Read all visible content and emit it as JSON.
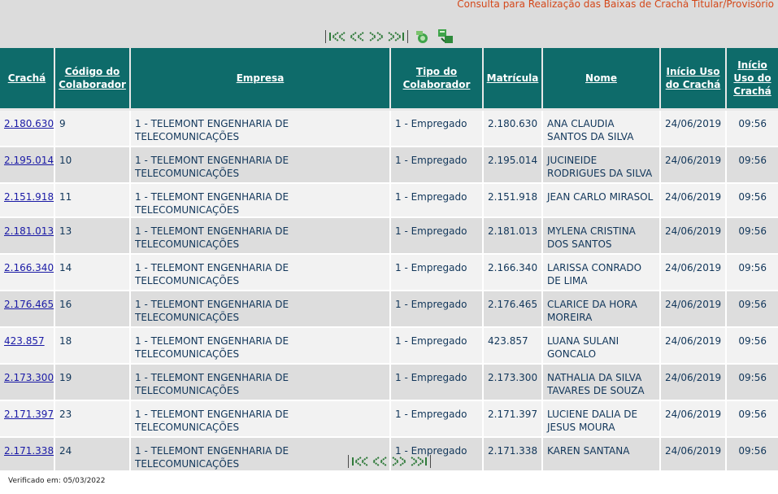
{
  "page": {
    "title": "Consulta para Realização das Baixas de Crachá Titular/Provisório",
    "footer": "Verificado em: 05/03/2022"
  },
  "colors": {
    "header_bg": "#0e6b6a",
    "title": "#d4481a",
    "link": "#1a1aa6",
    "cell_text": "#11365a"
  },
  "nav": {
    "icons": [
      "first-page-icon",
      "previous-page-icon",
      "next-page-icon",
      "last-page-icon"
    ],
    "tools": [
      "refresh-icon",
      "export-icon"
    ]
  },
  "table": {
    "headers": [
      "Crachá",
      "Código do Colaborador",
      "Empresa",
      "Tipo do Colaborador",
      "Matrícula",
      "Nome",
      "Início Uso do Crachá",
      "Início Uso do Crachá"
    ],
    "rows": [
      [
        "2.180.630",
        "9",
        "1 - TELEMONT ENGENHARIA DE TELECOMUNICAÇÕES",
        "1 - Empregado",
        "2.180.630",
        "ANA CLAUDIA SANTOS DA SILVA",
        "24/06/2019",
        "09:56"
      ],
      [
        "2.195.014",
        "10",
        "1 - TELEMONT ENGENHARIA DE TELECOMUNICAÇÕES",
        "1 - Empregado",
        "2.195.014",
        "JUCINEIDE RODRIGUES DA SILVA",
        "24/06/2019",
        "09:56"
      ],
      [
        "2.151.918",
        "11",
        "1 - TELEMONT ENGENHARIA DE TELECOMUNICAÇÕES",
        "1 - Empregado",
        "2.151.918",
        "JEAN CARLO MIRASOL",
        "24/06/2019",
        "09:56"
      ],
      [
        "2.181.013",
        "13",
        "1 - TELEMONT ENGENHARIA DE TELECOMUNICAÇÕES",
        "1 - Empregado",
        "2.181.013",
        "MYLENA CRISTINA DOS SANTOS",
        "24/06/2019",
        "09:56"
      ],
      [
        "2.166.340",
        "14",
        "1 - TELEMONT ENGENHARIA DE TELECOMUNICAÇÕES",
        "1 - Empregado",
        "2.166.340",
        "LARISSA CONRADO DE LIMA",
        "24/06/2019",
        "09:56"
      ],
      [
        "2.176.465",
        "16",
        "1 - TELEMONT ENGENHARIA DE TELECOMUNICAÇÕES",
        "1 - Empregado",
        "2.176.465",
        "CLARICE DA HORA MOREIRA",
        "24/06/2019",
        "09:56"
      ],
      [
        "423.857",
        "18",
        "1 - TELEMONT ENGENHARIA DE TELECOMUNICAÇÕES",
        "1 - Empregado",
        "423.857",
        "LUANA SULANI GONCALO",
        "24/06/2019",
        "09:56"
      ],
      [
        "2.173.300",
        "19",
        "1 - TELEMONT ENGENHARIA DE TELECOMUNICAÇÕES",
        "1 - Empregado",
        "2.173.300",
        "NATHALIA DA SILVA TAVARES DE SOUZA",
        "24/06/2019",
        "09:56"
      ],
      [
        "2.171.397",
        "23",
        "1 - TELEMONT ENGENHARIA DE TELECOMUNICAÇÕES",
        "1 - Empregado",
        "2.171.397",
        "LUCIENE DALIA DE JESUS MOURA",
        "24/06/2019",
        "09:56"
      ],
      [
        "2.171.338",
        "24",
        "1 - TELEMONT ENGENHARIA DE TELECOMUNICAÇÕES",
        "1 - Empregado",
        "2.171.338",
        "KAREN SANTANA",
        "24/06/2019",
        "09:56"
      ]
    ]
  }
}
